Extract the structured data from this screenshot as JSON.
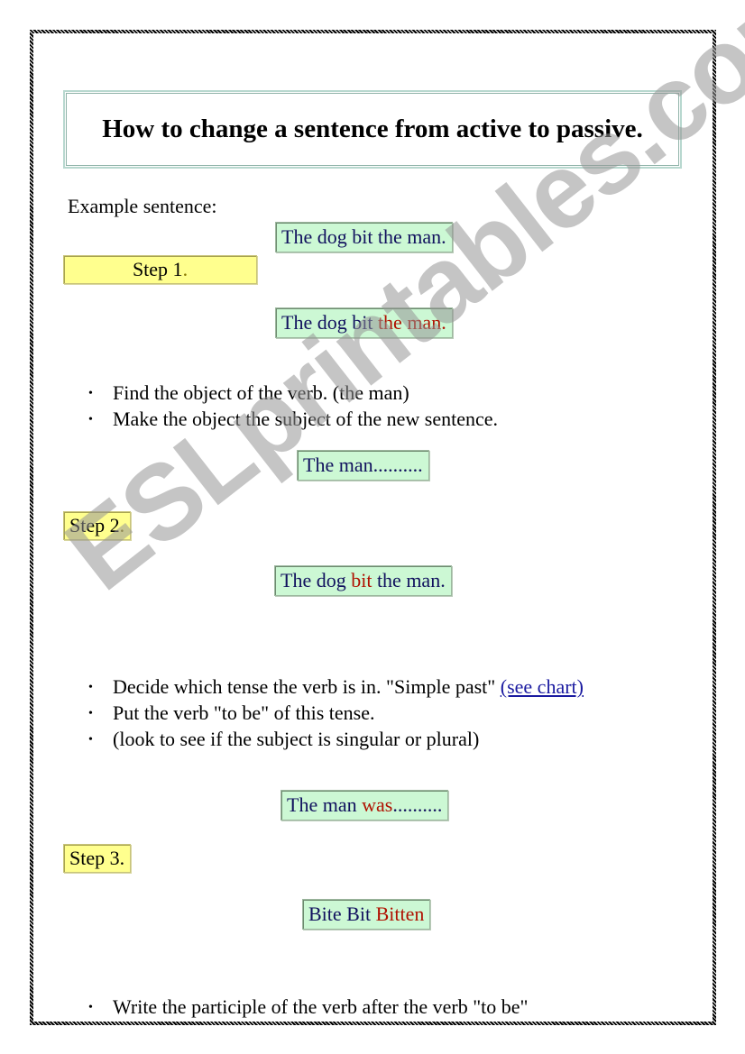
{
  "title": "How to change a sentence from active to passive.",
  "example_label": "Example sentence:",
  "example_sentence": "The dog bit the man.",
  "step1": {
    "label": "Step 1",
    "dot": ".",
    "sentence_parts": [
      "The dog bit ",
      "the man."
    ],
    "bullets": [
      "Find the object of the verb. (the man)",
      "Make the object the subject of the new sentence."
    ],
    "result": "The man.........."
  },
  "step2": {
    "label": "Step 2",
    "dot": ".",
    "sentence_parts": [
      "The dog ",
      "bit",
      " the man."
    ],
    "bullets": [
      "Decide which tense the verb is in. \"Simple past\" ",
      "Put the verb \"to be\" of this tense.",
      "(look to see if the subject is singular or plural)"
    ],
    "link": "(see chart)",
    "result_parts": [
      "The man ",
      "was",
      ".........."
    ]
  },
  "step3": {
    "label": "Step 3.",
    "forms_parts": [
      "Bite Bit ",
      "Bitten"
    ],
    "bullets": [
      "Write the participle of the verb after the verb \"to be\""
    ]
  },
  "watermark": "ESLprintables.com",
  "colors": {
    "sentence_text": "#11115e",
    "highlight_red": "#b01000",
    "green_box": "#ccf8d4",
    "yellow_box": "#ffff8e",
    "link": "#1a1aa0"
  }
}
